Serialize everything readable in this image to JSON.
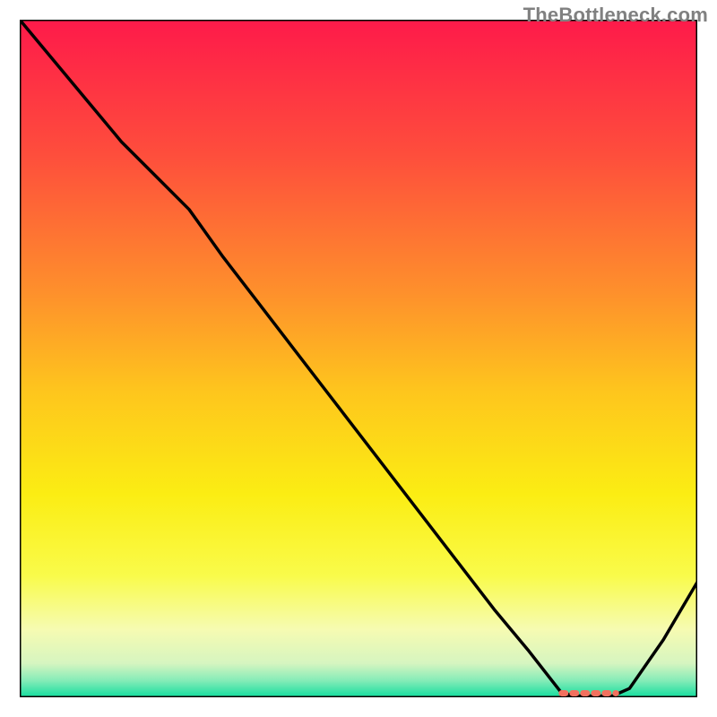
{
  "watermark": "TheBottleneck.com",
  "chart_data": {
    "type": "line",
    "title": "",
    "xlabel": "",
    "ylabel": "",
    "x": [
      0.0,
      0.05,
      0.1,
      0.15,
      0.2,
      0.25,
      0.3,
      0.35,
      0.4,
      0.45,
      0.5,
      0.55,
      0.6,
      0.65,
      0.7,
      0.75,
      0.8,
      0.825,
      0.85,
      0.875,
      0.9,
      0.95,
      1.0
    ],
    "y": [
      1.0,
      0.94,
      0.88,
      0.82,
      0.77,
      0.72,
      0.65,
      0.585,
      0.52,
      0.455,
      0.39,
      0.325,
      0.26,
      0.195,
      0.13,
      0.07,
      0.006,
      0.002,
      0.002,
      0.002,
      0.013,
      0.085,
      0.17
    ],
    "xlim": [
      0,
      1
    ],
    "ylim": [
      0,
      1
    ],
    "marker": {
      "x": [
        0.8,
        0.88
      ],
      "y": 0.006,
      "color": "#f2705e"
    },
    "series": [
      {
        "name": "curve",
        "color": "#000000"
      }
    ],
    "background_gradient": {
      "stops": [
        {
          "offset": 0.0,
          "color": "#fe1a4a"
        },
        {
          "offset": 0.2,
          "color": "#fe4e3c"
        },
        {
          "offset": 0.4,
          "color": "#fe8f2c"
        },
        {
          "offset": 0.55,
          "color": "#fec61d"
        },
        {
          "offset": 0.7,
          "color": "#fbed13"
        },
        {
          "offset": 0.82,
          "color": "#f9fb4a"
        },
        {
          "offset": 0.9,
          "color": "#f6fbb2"
        },
        {
          "offset": 0.95,
          "color": "#d6f5c0"
        },
        {
          "offset": 0.975,
          "color": "#86ecb8"
        },
        {
          "offset": 1.0,
          "color": "#13dd9e"
        }
      ]
    }
  }
}
